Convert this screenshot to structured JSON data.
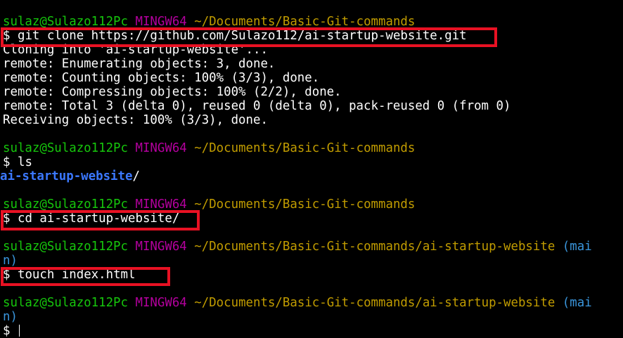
{
  "prompt": {
    "user_host": "sulaz@Sulazo112Pc",
    "system": "MINGW64",
    "path_repo_parent": "~/Documents/Basic-Git-commands",
    "path_repo": "~/Documents/Basic-Git-commands/ai-startup-website",
    "branch_part1": "(mai",
    "branch_part2": "n)",
    "symbol": "$"
  },
  "commands": {
    "clone": "git clone https://github.com/Sulazo112/ai-startup-website.git",
    "ls": "ls",
    "cd": "cd ai-startup-website/",
    "touch": "touch index.html"
  },
  "output": {
    "clone_lines": [
      "Cloning into 'ai-startup-website'...",
      "remote: Enumerating objects: 3, done.",
      "remote: Counting objects: 100% (3/3), done.",
      "remote: Compressing objects: 100% (2/2), done.",
      "remote: Total 3 (delta 0), reused 0 (delta 0), pack-reused 0 (from 0)",
      "Receiving objects: 100% (3/3), done."
    ],
    "ls_dir": "ai-startup-website",
    "ls_suffix": "/"
  },
  "colors": {
    "background": "#000000",
    "user_host": "#16c60c",
    "system": "#b4009e",
    "path": "#c19c00",
    "branch": "#3a96dd",
    "directory": "#3b78ff",
    "highlight_box": "#e81123"
  }
}
